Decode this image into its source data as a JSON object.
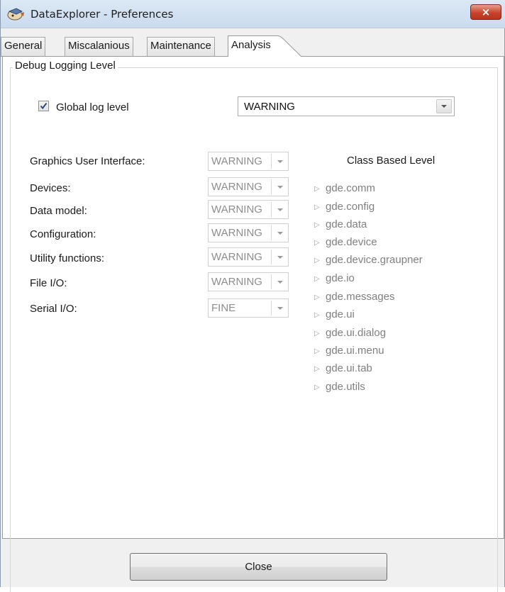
{
  "window": {
    "title": "DataExplorer - Preferences",
    "close_glyph": "×"
  },
  "tabs": [
    {
      "label": "General",
      "active": false
    },
    {
      "label": "Miscalanious",
      "active": false
    },
    {
      "label": "Maintenance",
      "active": false
    },
    {
      "label": "Analysis",
      "active": true
    }
  ],
  "debug": {
    "group_title": "Debug Logging Level",
    "global": {
      "checked": true,
      "label": "Global log level",
      "value": "WARNING"
    },
    "modules": [
      {
        "label": "Graphics User Interface:",
        "value": "WARNING"
      },
      {
        "label": "Devices:",
        "value": "WARNING"
      },
      {
        "label": "Data model:",
        "value": "WARNING"
      },
      {
        "label": "Configuration:",
        "value": "WARNING"
      },
      {
        "label": "Utility functions:",
        "value": "WARNING"
      },
      {
        "label": "File I/O:",
        "value": "WARNING"
      },
      {
        "label": "Serial I/O:",
        "value": "FINE"
      }
    ],
    "class_heading": "Class Based Level",
    "classes": [
      "gde.comm",
      "gde.config",
      "gde.data",
      "gde.device",
      "gde.device.graupner",
      "gde.io",
      "gde.messages",
      "gde.ui",
      "gde.ui.dialog",
      "gde.ui.menu",
      "gde.ui.tab",
      "gde.utils"
    ]
  },
  "footer": {
    "close_label": "Close"
  },
  "colors": {
    "disabled_text": "#8d8d8d",
    "tree_text": "#808080",
    "close_button_red": "#c8432c"
  },
  "icons": {
    "app": "app-logo-icon",
    "tree_expand": "expand-triangle-icon",
    "dropdown": "chevron-down-icon",
    "check": "check-icon"
  }
}
